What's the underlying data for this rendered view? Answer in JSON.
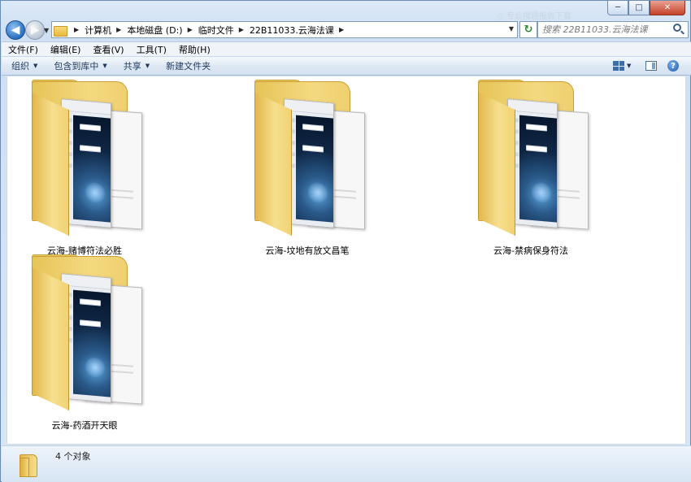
{
  "window": {
    "caption": {
      "minimize": "─",
      "maximize": "□",
      "close": "✕"
    },
    "watermark": "◎ 专业搜题报告下载"
  },
  "nav": {
    "back_glyph": "◀",
    "forward_glyph": "▶",
    "breadcrumbs": [
      {
        "label": "计算机"
      },
      {
        "label": "本地磁盘 (D:)"
      },
      {
        "label": "临时文件"
      },
      {
        "label": "22B11033.云海法课"
      }
    ],
    "refresh_glyph": "↻",
    "search_placeholder": "搜索 22B11033.云海法课"
  },
  "menu": {
    "items": [
      {
        "label": "文件(F)"
      },
      {
        "label": "编辑(E)"
      },
      {
        "label": "查看(V)"
      },
      {
        "label": "工具(T)"
      },
      {
        "label": "帮助(H)"
      }
    ]
  },
  "commands": {
    "organize": "组织",
    "include_in_library": "包含到库中",
    "share": "共享",
    "new_folder": "新建文件夹",
    "help_glyph": "?"
  },
  "folders": [
    {
      "name": "云海-赌博符法必胜"
    },
    {
      "name": "云海-坟地有放文昌笔"
    },
    {
      "name": "云海-禁病保身符法"
    },
    {
      "name": "云海-药酒开天眼"
    }
  ],
  "status": {
    "text": "4 个对象"
  }
}
